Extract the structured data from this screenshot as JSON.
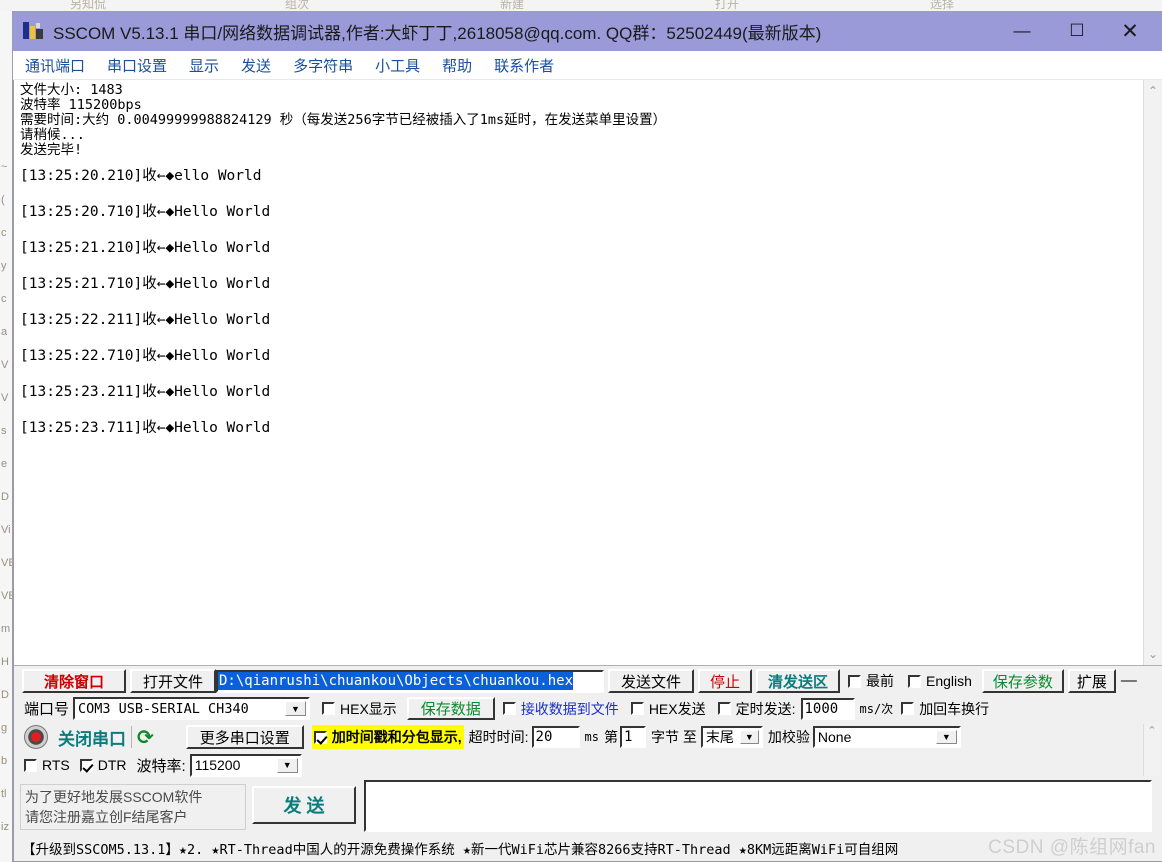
{
  "background_app": {
    "toolbar_items": [
      "另知侃",
      "组次",
      "新建",
      "打开",
      "选择"
    ],
    "side_fragments": [
      "~",
      "(",
      "c",
      "y",
      "c",
      "a",
      "V",
      "V",
      "s",
      "e",
      "D",
      "Vi",
      "VE",
      "VE",
      "m",
      "H",
      "D",
      "g",
      "b",
      "tl",
      "iz"
    ]
  },
  "window": {
    "title": "SSCOM V5.13.1 串口/网络数据调试器,作者:大虾丁丁,2618058@qq.com. QQ群：52502449(最新版本)",
    "icon": "sscom-app-icon",
    "minimize_label": "—",
    "maximize_label": "☐",
    "close_label": "✕"
  },
  "menubar": {
    "items": [
      {
        "label": "通讯端口"
      },
      {
        "label": "串口设置"
      },
      {
        "label": "显示"
      },
      {
        "label": "发送"
      },
      {
        "label": "多字符串"
      },
      {
        "label": "小工具"
      },
      {
        "label": "帮助"
      },
      {
        "label": "联系作者"
      }
    ]
  },
  "terminal": {
    "header_lines": [
      "文件大小: 1483",
      "波特率 115200bps",
      "需要时间:大约 0.00499999988824129 秒（每发送256字节已经被插入了1ms延时，在发送菜单里设置）",
      "请稍候...",
      "发送完毕!"
    ],
    "log_lines": [
      {
        "time": "[13:25:20.210]",
        "dir": "收←◆",
        "text": "ello World"
      },
      {
        "time": "[13:25:20.710]",
        "dir": "收←◆",
        "text": "Hello World"
      },
      {
        "time": "[13:25:21.210]",
        "dir": "收←◆",
        "text": "Hello World"
      },
      {
        "time": "[13:25:21.710]",
        "dir": "收←◆",
        "text": "Hello World"
      },
      {
        "time": "[13:25:22.211]",
        "dir": "收←◆",
        "text": "Hello World"
      },
      {
        "time": "[13:25:22.710]",
        "dir": "收←◆",
        "text": "Hello World"
      },
      {
        "time": "[13:25:23.211]",
        "dir": "收←◆",
        "text": "Hello World"
      },
      {
        "time": "[13:25:23.711]",
        "dir": "收←◆",
        "text": "Hello World"
      }
    ],
    "scroll_up": "⌃",
    "scroll_down": "⌄"
  },
  "toolbar_row1": {
    "clear_window": "清除窗口",
    "open_file": "打开文件",
    "file_path": "D:\\qianrushi\\chuankou\\Objects\\chuankou.hex",
    "send_file": "发送文件",
    "stop": "停止",
    "clear_send_area": "清发送区",
    "topmost_label": "最前",
    "topmost_checked": false,
    "english_label": "English",
    "english_checked": false,
    "save_params": "保存参数",
    "extend": "扩展",
    "extend_more": "—"
  },
  "toolbar_row2": {
    "port_label": "端口号",
    "port_value": "COM3 USB-SERIAL CH340",
    "hex_display_label": "HEX显示",
    "hex_display_checked": false,
    "save_data": "保存数据",
    "recv_to_file_label": "接收数据到文件",
    "recv_to_file_checked": false,
    "hex_send_label": "HEX发送",
    "hex_send_checked": false,
    "timed_send_label": "定时发送:",
    "timed_send_checked": false,
    "timed_send_value": "1000",
    "timed_send_unit": "ms/次",
    "crlf_label": "加回车换行",
    "crlf_checked": false
  },
  "toolbar_row3": {
    "close_port": "关闭串口",
    "port_icon": "serial-port-indicator-icon",
    "refresh_icon": "refresh-icon",
    "more_settings": "更多串口设置",
    "timestamp_label": "加时间戳和分包显示,",
    "timestamp_checked": true,
    "timeout_label": "超时时间:",
    "timeout_value": "20",
    "timeout_unit": "ms",
    "byte_prefix": "第",
    "byte_value": "1",
    "byte_suffix": "字节 至",
    "range_end": "末尾",
    "checksum_label": "加校验",
    "checksum_value": "None"
  },
  "toolbar_row4": {
    "rts_label": "RTS",
    "rts_checked": false,
    "dtr_label": "DTR",
    "dtr_checked": true,
    "baud_label": "波特率:",
    "baud_value": "115200"
  },
  "promo": {
    "line1": "为了更好地发展SSCOM软件",
    "line2": "请您注册嘉立创F结尾客户",
    "send_button": "发  送"
  },
  "statusbar": {
    "text": "【升级到SSCOM5.13.1】★2.  ★RT-Thread中国人的开源免费操作系统 ★新一代WiFi芯片兼容8266支持RT-Thread ★8KM远距离WiFi可自组网",
    "watermark": "CSDN @陈组网fan"
  },
  "colors": {
    "titlebar": "#9a9ad8",
    "menu_text": "#1a4fa0",
    "accent_red": "#cc0000",
    "accent_green": "#0b8a2c",
    "accent_teal": "#0b7c7c",
    "accent_blue": "#1a30c8",
    "highlight_yellow": "#ffff00",
    "selection_blue": "#0a60d8"
  }
}
